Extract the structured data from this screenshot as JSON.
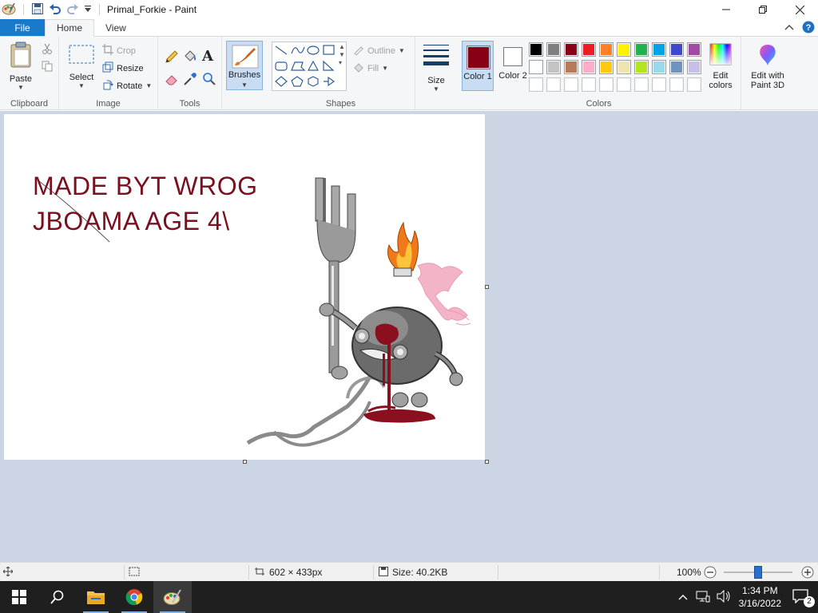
{
  "window": {
    "title": "Primal_Forkie - Paint"
  },
  "tabs": {
    "file": "File",
    "home": "Home",
    "view": "View"
  },
  "clipboard": {
    "paste": "Paste",
    "label": "Clipboard"
  },
  "image": {
    "select": "Select",
    "crop": "Crop",
    "resize": "Resize",
    "rotate": "Rotate",
    "label": "Image"
  },
  "tools": {
    "label": "Tools"
  },
  "brushes": {
    "label": "Brushes"
  },
  "shapes": {
    "outline": "Outline",
    "fill": "Fill",
    "label": "Shapes"
  },
  "size": {
    "label": "Size"
  },
  "colors": {
    "color1_label": "Color 1",
    "color2_label": "Color 2",
    "edit_colors": "Edit colors",
    "paint3d": "Edit with Paint 3D",
    "label": "Colors",
    "color1": "#880015",
    "color2": "#ffffff",
    "palette_row1": [
      "#000000",
      "#7f7f7f",
      "#880015",
      "#ed1c24",
      "#ff7f27",
      "#fff200",
      "#22b14c",
      "#00a2e8",
      "#3f48cc",
      "#a349a4"
    ],
    "palette_row2": [
      "#ffffff",
      "#c3c3c3",
      "#b97a57",
      "#ffaec9",
      "#ffc90e",
      "#efe4b0",
      "#b5e61d",
      "#99d9ea",
      "#7092be",
      "#c8bfe7"
    ],
    "palette_row3": [
      "#ffffff",
      "#ffffff",
      "#ffffff",
      "#ffffff",
      "#ffffff",
      "#ffffff",
      "#ffffff",
      "#ffffff",
      "#ffffff",
      "#ffffff"
    ]
  },
  "canvas": {
    "line1": "MADE BYT WROG",
    "line2": "JBOAMA AGE 4\\"
  },
  "status": {
    "dimensions": "602 × 433px",
    "size": "Size: 40.2KB",
    "zoom": "100%",
    "zoom_level": 1.0
  },
  "taskbar": {
    "time": "1:34 PM",
    "date": "3/16/2022",
    "notifications": "2"
  }
}
